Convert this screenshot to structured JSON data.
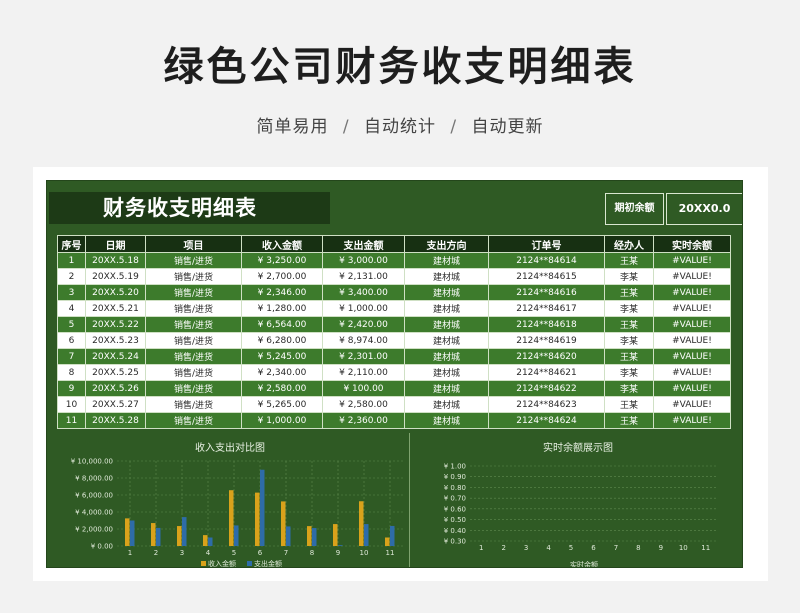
{
  "header": {
    "title": "绿色公司财务收支明细表",
    "subtitle_parts": [
      "简单易用",
      "自动统计",
      "自动更新"
    ],
    "separator": "/"
  },
  "sheet": {
    "title": "财务收支明细表",
    "balance_label": "期初余额",
    "balance_value": "20XX0.0"
  },
  "table": {
    "columns": [
      "序号",
      "日期",
      "项目",
      "收入金额",
      "支出金额",
      "支出方向",
      "订单号",
      "经办人",
      "实时余额"
    ],
    "rows": [
      [
        "1",
        "20XX.5.18",
        "销售/进货",
        "¥ 3,250.00",
        "¥ 3,000.00",
        "建材城",
        "2124**84614",
        "王某",
        "#VALUE!"
      ],
      [
        "2",
        "20XX.5.19",
        "销售/进货",
        "¥ 2,700.00",
        "¥ 2,131.00",
        "建材城",
        "2124**84615",
        "李某",
        "#VALUE!"
      ],
      [
        "3",
        "20XX.5.20",
        "销售/进货",
        "¥ 2,346.00",
        "¥ 3,400.00",
        "建材城",
        "2124**84616",
        "王某",
        "#VALUE!"
      ],
      [
        "4",
        "20XX.5.21",
        "销售/进货",
        "¥ 1,280.00",
        "¥ 1,000.00",
        "建材城",
        "2124**84617",
        "李某",
        "#VALUE!"
      ],
      [
        "5",
        "20XX.5.22",
        "销售/进货",
        "¥ 6,564.00",
        "¥ 2,420.00",
        "建材城",
        "2124**84618",
        "王某",
        "#VALUE!"
      ],
      [
        "6",
        "20XX.5.23",
        "销售/进货",
        "¥ 6,280.00",
        "¥ 8,974.00",
        "建材城",
        "2124**84619",
        "李某",
        "#VALUE!"
      ],
      [
        "7",
        "20XX.5.24",
        "销售/进货",
        "¥ 5,245.00",
        "¥ 2,301.00",
        "建材城",
        "2124**84620",
        "王某",
        "#VALUE!"
      ],
      [
        "8",
        "20XX.5.25",
        "销售/进货",
        "¥ 2,340.00",
        "¥ 2,110.00",
        "建材城",
        "2124**84621",
        "李某",
        "#VALUE!"
      ],
      [
        "9",
        "20XX.5.26",
        "销售/进货",
        "¥ 2,580.00",
        "¥ 100.00",
        "建材城",
        "2124**84622",
        "李某",
        "#VALUE!"
      ],
      [
        "10",
        "20XX.5.27",
        "销售/进货",
        "¥ 5,265.00",
        "¥ 2,580.00",
        "建材城",
        "2124**84623",
        "王某",
        "#VALUE!"
      ],
      [
        "11",
        "20XX.5.28",
        "销售/进货",
        "¥ 1,000.00",
        "¥ 2,360.00",
        "建材城",
        "2124**84624",
        "王某",
        "#VALUE!"
      ]
    ]
  },
  "chart_data": [
    {
      "type": "bar",
      "title": "收入支出对比图",
      "categories": [
        "1",
        "2",
        "3",
        "4",
        "5",
        "6",
        "7",
        "8",
        "9",
        "10",
        "11"
      ],
      "y_tick_labels": [
        "¥ 10,000.00",
        "¥ 8,000.00",
        "¥ 6,000.00",
        "¥ 4,000.00",
        "¥ 2,000.00",
        "¥ 0.00"
      ],
      "ylim": [
        0,
        10000
      ],
      "series": [
        {
          "name": "收入金额",
          "values": [
            3250,
            2700,
            2346,
            1280,
            6564,
            6280,
            5245,
            2340,
            2580,
            5265,
            1000
          ],
          "color": "#d9a21b"
        },
        {
          "name": "支出金额",
          "values": [
            3000,
            2131,
            3400,
            1000,
            2420,
            8974,
            2301,
            2110,
            100,
            2580,
            2360
          ],
          "color": "#2e6ca8"
        }
      ],
      "grid": true,
      "legend": "bottom"
    },
    {
      "type": "line",
      "title": "实时余额展示图",
      "categories": [
        "1",
        "2",
        "3",
        "4",
        "5",
        "6",
        "7",
        "8",
        "9",
        "10",
        "11"
      ],
      "y_tick_labels": [
        "¥ 1.00",
        "¥ 0.90",
        "¥ 0.80",
        "¥ 0.70",
        "¥ 0.60",
        "¥ 0.50",
        "¥ 0.40",
        "¥ 0.30"
      ],
      "ylim": [
        0.3,
        1.0
      ],
      "series": [
        {
          "name": "实时余额",
          "values": []
        }
      ],
      "grid": true,
      "legend": "bottom"
    }
  ],
  "colors": {
    "sheet_bg": "#2f5a24",
    "row_green": "#3d7b2c",
    "header_dark": "#173012",
    "income": "#d9a21b",
    "expense": "#2e6ca8"
  }
}
